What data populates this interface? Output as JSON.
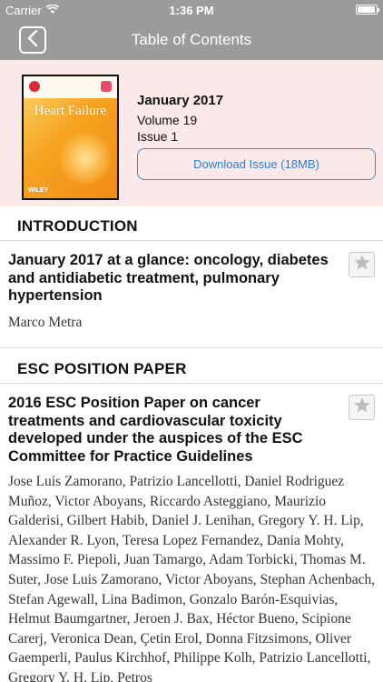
{
  "status_bar": {
    "carrier": "Carrier",
    "time": "1:36 PM"
  },
  "nav": {
    "title": "Table of Contents"
  },
  "issue": {
    "date": "January 2017",
    "volume": "Volume 19",
    "issue": "Issue 1",
    "download_label": "Download Issue (18MB)",
    "cover_title": "Heart Failure",
    "cover_publisher": "WILEY"
  },
  "sections": [
    {
      "heading": "INTRODUCTION",
      "articles": [
        {
          "title": "January 2017 at a glance: oncology, diabetes and antidiabetic treatment, pulmonary hypertension",
          "authors": "Marco Metra"
        }
      ]
    },
    {
      "heading": "ESC POSITION PAPER",
      "articles": [
        {
          "title": "2016 ESC Position Paper on cancer treatments and cardiovascular toxicity developed under the auspices of the ESC Committee for Practice Guidelines",
          "authors": "Jose Luis Zamorano, Patrizio Lancellotti, Daniel Rodriguez Muñoz, Victor Aboyans, Riccardo Asteggiano, Maurizio Galderisi, Gilbert Habib, Daniel J. Lenihan, Gregory Y. H. Lip, Alexander R. Lyon, Teresa Lopez Fernandez, Dania Mohty, Massimo F. Piepoli, Juan Tamargo, Adam Torbicki, Thomas M. Suter, Jose Luis Zamorano, Victor Aboyans, Stephan Achenbach, Stefan Agewall, Lina Badimon, Gonzalo Barón-Esquivias, Helmut Baumgartner, Jeroen J. Bax, Héctor Bueno, Scipione Carerj, Veronica Dean, Çetin Erol, Donna Fitzsimons, Oliver Gaemperli, Paulus Kirchhof, Philippe Kolh, Patrizio Lancellotti, Gregory Y. H. Lip, Petros"
        }
      ]
    }
  ]
}
